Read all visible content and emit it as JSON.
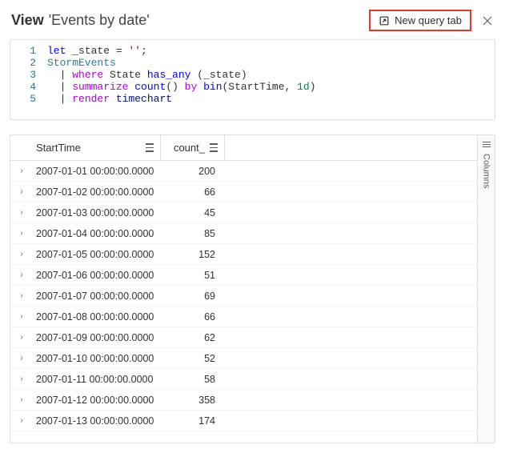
{
  "header": {
    "title_prefix": "View",
    "title_name": "'Events by date'",
    "new_query_label": "New query tab"
  },
  "code": {
    "lines": [
      {
        "n": "1",
        "tokens": [
          [
            "kw",
            "let"
          ],
          [
            "",
            " _state = "
          ],
          [
            "lit",
            "''"
          ],
          [
            "",
            ";"
          ]
        ]
      },
      {
        "n": "2",
        "tokens": [
          [
            "tbl",
            "StormEvents"
          ]
        ]
      },
      {
        "n": "3",
        "tokens": [
          [
            "pipe",
            "  | "
          ],
          [
            "op-purple",
            "where"
          ],
          [
            "",
            " State "
          ],
          [
            "fn",
            "has_any"
          ],
          [
            "",
            " (_state)"
          ]
        ]
      },
      {
        "n": "4",
        "tokens": [
          [
            "pipe",
            "  | "
          ],
          [
            "op-purple",
            "summarize"
          ],
          [
            "",
            " "
          ],
          [
            "fn",
            "count"
          ],
          [
            "",
            "() "
          ],
          [
            "op-purple",
            "by"
          ],
          [
            "",
            " "
          ],
          [
            "fn",
            "bin"
          ],
          [
            "",
            "(StartTime, "
          ],
          [
            "num",
            "1d"
          ],
          [
            "",
            ")"
          ]
        ]
      },
      {
        "n": "5",
        "tokens": [
          [
            "pipe",
            "  | "
          ],
          [
            "op-purple",
            "render"
          ],
          [
            "",
            " "
          ],
          [
            "ident",
            "timechart"
          ]
        ]
      }
    ]
  },
  "table": {
    "columns": {
      "start": "StartTime",
      "count": "count_"
    },
    "columns_tab": "Columns",
    "rows": [
      {
        "start": "2007-01-01 00:00:00.0000",
        "count": "200"
      },
      {
        "start": "2007-01-02 00:00:00.0000",
        "count": "66"
      },
      {
        "start": "2007-01-03 00:00:00.0000",
        "count": "45"
      },
      {
        "start": "2007-01-04 00:00:00.0000",
        "count": "85"
      },
      {
        "start": "2007-01-05 00:00:00.0000",
        "count": "152"
      },
      {
        "start": "2007-01-06 00:00:00.0000",
        "count": "51"
      },
      {
        "start": "2007-01-07 00:00:00.0000",
        "count": "69"
      },
      {
        "start": "2007-01-08 00:00:00.0000",
        "count": "66"
      },
      {
        "start": "2007-01-09 00:00:00.0000",
        "count": "62"
      },
      {
        "start": "2007-01-10 00:00:00.0000",
        "count": "52"
      },
      {
        "start": "2007-01-11 00:00:00.0000",
        "count": "58"
      },
      {
        "start": "2007-01-12 00:00:00.0000",
        "count": "358"
      },
      {
        "start": "2007-01-13 00:00:00.0000",
        "count": "174"
      }
    ]
  }
}
